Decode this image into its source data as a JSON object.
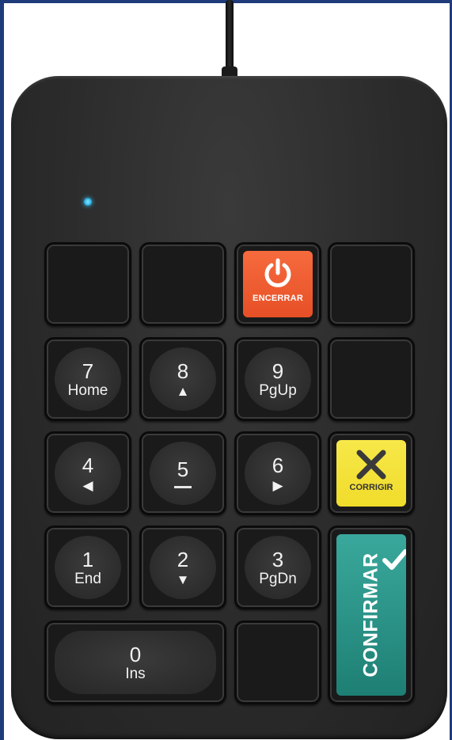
{
  "keys": {
    "power": {
      "label": "ENCERRAR"
    },
    "k7": {
      "num": "7",
      "sub": "Home"
    },
    "k8": {
      "num": "8",
      "sub": "▲"
    },
    "k9": {
      "num": "9",
      "sub": "PgUp"
    },
    "k4": {
      "num": "4",
      "sub": "◀"
    },
    "k5": {
      "num": "5"
    },
    "k6": {
      "num": "6",
      "sub": "▶"
    },
    "corrigir": {
      "label": "CORRIGIR"
    },
    "k1": {
      "num": "1",
      "sub": "End"
    },
    "k2": {
      "num": "2",
      "sub": "▼"
    },
    "k3": {
      "num": "3",
      "sub": "PgDn"
    },
    "confirmar": {
      "label": "CONFIRMAR"
    },
    "k0": {
      "num": "0",
      "sub": "Ins"
    }
  },
  "colors": {
    "power": "#e8552b",
    "corrigir": "#f2de2e",
    "confirmar": "#268b80",
    "led": "#2ab3e6",
    "body": "#2b2b2b"
  },
  "icons": {
    "power": "power-icon",
    "corrigir": "x-icon",
    "confirmar": "checkmark-icon",
    "led": "status-led"
  }
}
